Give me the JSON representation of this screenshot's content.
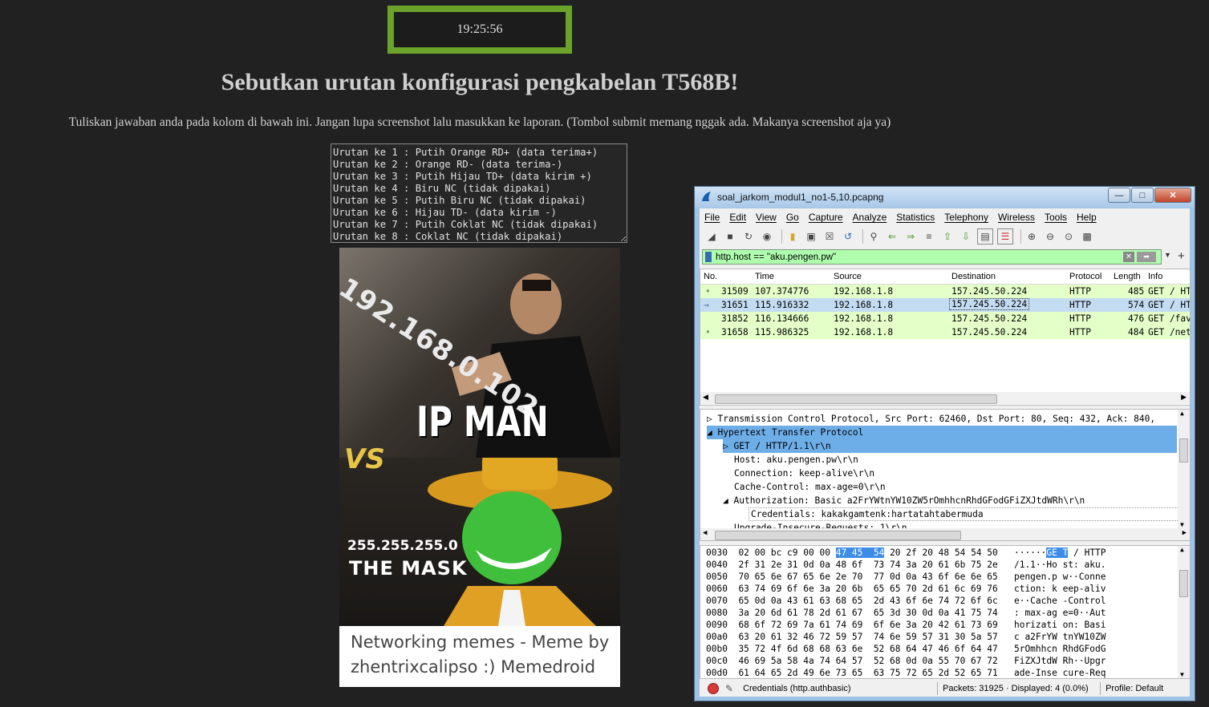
{
  "timer": "19:25:56",
  "page_title": "Sebutkan urutan konfigurasi pengkabelan T568B!",
  "instructions": "Tuliskan jawaban anda pada kolom di bawah ini. Jangan lupa screenshot lalu masukkan ke laporan. (Tombol submit memang nggak ada. Makanya screenshot aja ya)",
  "answer_text": "Urutan ke 1 : Putih Orange RD+ (data terima+)\nUrutan ke 2 : Orange RD- (data terima-)\nUrutan ke 3 : Putih Hijau TD+ (data kirim +)\nUrutan ke 4 : Biru NC (tidak dipakai)\nUrutan ke 5 : Putih Biru NC (tidak dipakai)\nUrutan ke 6 : Hijau TD- (data kirim -)\nUrutan ke 7 : Putih Coklat NC (tidak dipakai)\nUrutan ke 8 : Coklat NC (tidak dipakai)",
  "meme": {
    "ip_text": "192.168.0.102",
    "ipman": "IP MAN",
    "vs": "VS",
    "mask_ip": "255.255.255.0",
    "mask_label": "THE MASK",
    "caption_line1": "Networking memes - Meme by",
    "caption_line2": "zhentrixcalipso :) Memedroid"
  },
  "wireshark": {
    "title": "soal_jarkom_modul1_no1-5,10.pcapng",
    "menu": [
      "File",
      "Edit",
      "View",
      "Go",
      "Capture",
      "Analyze",
      "Statistics",
      "Telephony",
      "Wireless",
      "Tools",
      "Help"
    ],
    "filter_value": "http.host == \"aku.pengen.pw\"",
    "columns": [
      "No.",
      "Time",
      "Source",
      "Destination",
      "Protocol",
      "Length",
      "Info"
    ],
    "packets": [
      {
        "no": "31509",
        "time": "107.374776",
        "src": "192.168.1.8",
        "dst": "157.245.50.224",
        "proto": "HTTP",
        "len": "485",
        "info": "GET / HT"
      },
      {
        "no": "31651",
        "time": "115.916332",
        "src": "192.168.1.8",
        "dst": "157.245.50.224",
        "proto": "HTTP",
        "len": "574",
        "info": "GET / HT"
      },
      {
        "no": "31852",
        "time": "116.134666",
        "src": "192.168.1.8",
        "dst": "157.245.50.224",
        "proto": "HTTP",
        "len": "476",
        "info": "GET /fav"
      },
      {
        "no": "31658",
        "time": "115.986325",
        "src": "192.168.1.8",
        "dst": "157.245.50.224",
        "proto": "HTTP",
        "len": "484",
        "info": "GET /net"
      }
    ],
    "details": [
      "Transmission Control Protocol, Src Port: 62460, Dst Port: 80, Seq: 432, Ack: 840,",
      "Hypertext Transfer Protocol",
      "GET / HTTP/1.1\\r\\n",
      "Host: aku.pengen.pw\\r\\n",
      "Connection: keep-alive\\r\\n",
      "Cache-Control: max-age=0\\r\\n",
      "Authorization: Basic a2FrYWtnYW10ZW5rOmhhcnRhdGFodGFiZXJtdWRh\\r\\n",
      "Credentials: kakakgamtenk:hartatahtabermuda",
      "Upgrade-Insecure-Requests: 1\\r\\n"
    ],
    "bytes": [
      {
        "off": "0030",
        "hex1": "02 00 bc c9 00 00",
        "hl": "47 45  54",
        "hex2": " 20 2f 20 48 54 54 50",
        "asc1": "······",
        "ahl": "GE T",
        "asc2": " / HTTP"
      },
      {
        "off": "0040",
        "hex1": "2f 31 2e 31 0d 0a 48 6f  73 74 3a 20 61 6b 75 2e",
        "hl": "",
        "hex2": "",
        "asc1": "/1.1··Ho st: aku.",
        "ahl": "",
        "asc2": ""
      },
      {
        "off": "0050",
        "hex1": "70 65 6e 67 65 6e 2e 70  77 0d 0a 43 6f 6e 6e 65",
        "hl": "",
        "hex2": "",
        "asc1": "pengen.p w··Conne",
        "ahl": "",
        "asc2": ""
      },
      {
        "off": "0060",
        "hex1": "63 74 69 6f 6e 3a 20 6b  65 65 70 2d 61 6c 69 76",
        "hl": "",
        "hex2": "",
        "asc1": "ction: k eep-aliv",
        "ahl": "",
        "asc2": ""
      },
      {
        "off": "0070",
        "hex1": "65 0d 0a 43 61 63 68 65  2d 43 6f 6e 74 72 6f 6c",
        "hl": "",
        "hex2": "",
        "asc1": "e··Cache -Control",
        "ahl": "",
        "asc2": ""
      },
      {
        "off": "0080",
        "hex1": "3a 20 6d 61 78 2d 61 67  65 3d 30 0d 0a 41 75 74",
        "hl": "",
        "hex2": "",
        "asc1": ": max-ag e=0··Aut",
        "ahl": "",
        "asc2": ""
      },
      {
        "off": "0090",
        "hex1": "68 6f 72 69 7a 61 74 69  6f 6e 3a 20 42 61 73 69",
        "hl": "",
        "hex2": "",
        "asc1": "horizati on: Basi",
        "ahl": "",
        "asc2": ""
      },
      {
        "off": "00a0",
        "hex1": "63 20 61 32 46 72 59 57  74 6e 59 57 31 30 5a 57",
        "hl": "",
        "hex2": "",
        "asc1": "c a2FrYW tnYW10ZW",
        "ahl": "",
        "asc2": ""
      },
      {
        "off": "00b0",
        "hex1": "35 72 4f 6d 68 68 63 6e  52 68 64 47 46 6f 64 47",
        "hl": "",
        "hex2": "",
        "asc1": "5rOmhhcn RhdGFodG",
        "ahl": "",
        "asc2": ""
      },
      {
        "off": "00c0",
        "hex1": "46 69 5a 58 4a 74 64 57  52 68 0d 0a 55 70 67 72",
        "hl": "",
        "hex2": "",
        "asc1": "FiZXJtdW Rh··Upgr",
        "ahl": "",
        "asc2": ""
      },
      {
        "off": "00d0",
        "hex1": "61 64 65 2d 49 6e 73 65  63 75 72 65 2d 52 65 71",
        "hl": "",
        "hex2": "",
        "asc1": "ade-Inse cure-Req",
        "ahl": "",
        "asc2": ""
      }
    ],
    "status_left": "Credentials (http.authbasic)",
    "status_packets": "Packets: 31925 · Displayed: 4 (0.0%)",
    "status_profile": "Profile: Default"
  }
}
